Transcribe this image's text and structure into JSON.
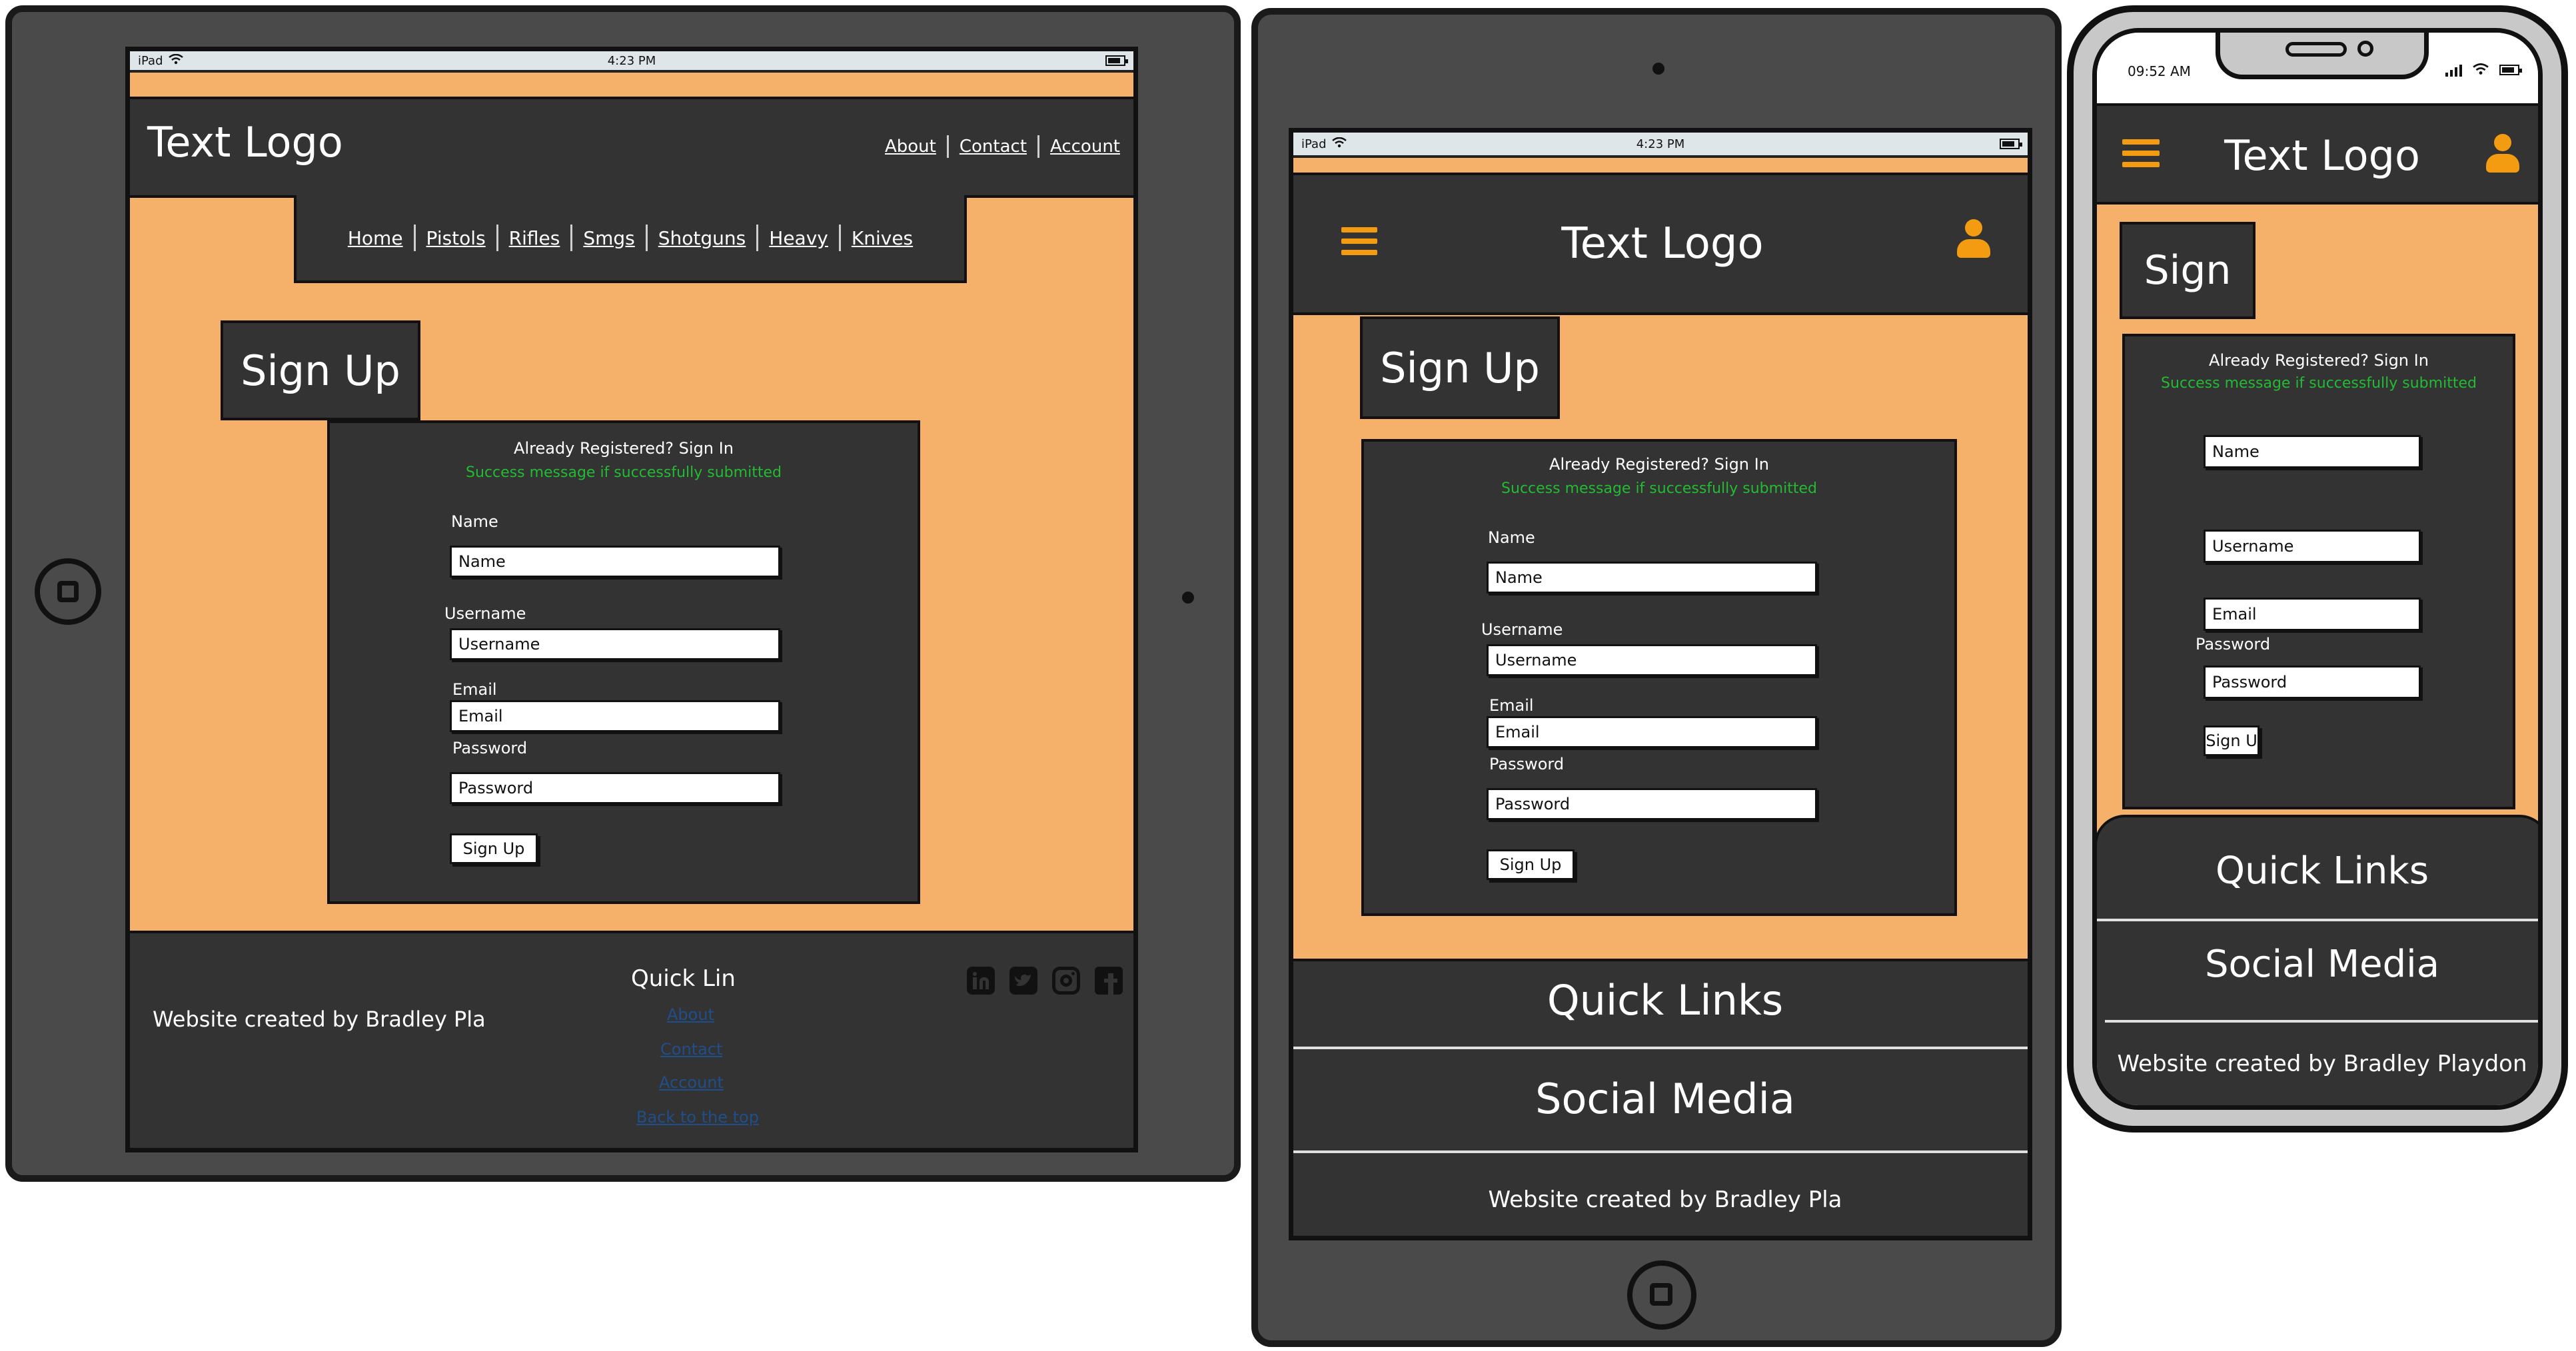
{
  "tablet": {
    "status": {
      "carrier": "iPad",
      "time": "4:23 PM"
    },
    "logo": "Text Logo",
    "top_nav": [
      "About",
      "Contact",
      "Account"
    ],
    "main_nav": [
      "Home",
      "Pistols",
      "Rifles",
      "Smgs",
      "Shotguns",
      "Heavy",
      "Knives"
    ],
    "page_title": "Sign Up",
    "form": {
      "already": "Already Registered? Sign In",
      "success": "Success message if successfully submitted",
      "name_label": "Name",
      "name_value": "Name",
      "username_label": "Username",
      "username_value": "Username",
      "email_label": "Email",
      "email_value": "Email",
      "password_label": "Password",
      "password_value": "Password",
      "submit": "Sign Up"
    },
    "footer": {
      "credit": "Website created by Bradley Pla",
      "quick_title": "Quick Lin",
      "links": [
        "About",
        "Contact",
        "Account",
        "Back to the top"
      ],
      "social": [
        "linkedin-icon",
        "twitter-icon",
        "instagram-icon",
        "facebook-icon"
      ]
    }
  },
  "ipad_portrait": {
    "status": {
      "carrier": "iPad",
      "time": "4:23 PM"
    },
    "logo": "Text Logo",
    "page_title": "Sign Up",
    "form": {
      "already": "Already Registered? Sign In",
      "success": "Success message if successfully submitted",
      "name_label": "Name",
      "name_value": "Name",
      "username_label": "Username",
      "username_value": "Username",
      "email_label": "Email",
      "email_value": "Email",
      "password_label": "Password",
      "password_value": "Password",
      "submit": "Sign Up"
    },
    "footer": {
      "quick_links": "Quick Links",
      "social_media": "Social Media",
      "credit": "Website created by Bradley Pla"
    }
  },
  "phone": {
    "status": {
      "time": "09:52 AM"
    },
    "logo": "Text Logo",
    "page_title": "Sign",
    "form": {
      "already": "Already Registered? Sign In",
      "success": "Success message if successfully submitted",
      "name_value": "Name",
      "username_value": "Username",
      "email_value": "Email",
      "password_label": "Password",
      "password_value": "Password",
      "submit": "Sign U"
    },
    "footer": {
      "quick_links": "Quick Links",
      "social_media": "Social Media",
      "credit": "Website created by Bradley Playdon"
    }
  },
  "colors": {
    "accent": "#f39c12",
    "page_bg": "#f5b06a",
    "panel": "#333333",
    "success": "#22bb33",
    "link": "#1f4f8a"
  }
}
